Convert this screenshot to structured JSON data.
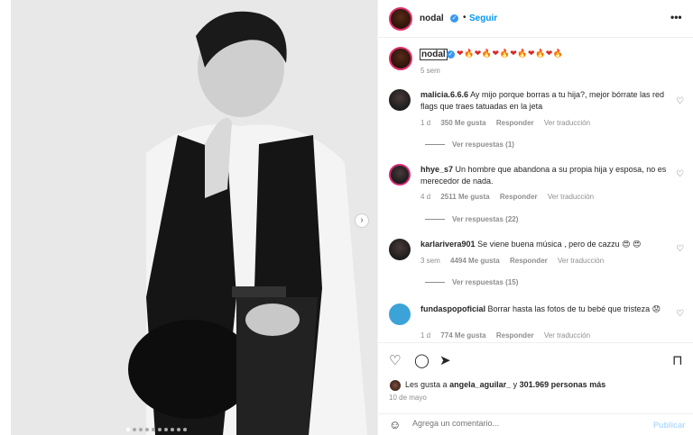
{
  "post": {
    "username": "nodal",
    "follow_label": "Seguir",
    "separator": "•",
    "more_label": "•••"
  },
  "caption": {
    "username": "nodal",
    "text": "❤🔥❤🔥❤🔥❤🔥❤🔥❤🔥",
    "time": "5 sem"
  },
  "comments": [
    {
      "user": "malicia.6.6.6",
      "text": "Ay mijo porque borras a tu hija?, mejor bórrate las red flags que traes tatuadas en la jeta",
      "time": "1 d",
      "likes": "350 Me gusta",
      "reply_label": "Responder",
      "translate_label": "Ver traducción",
      "replies": "Ver respuestas (1)"
    },
    {
      "user": "hhye_s7",
      "text": "Un hombre que abandona a su propia hija y esposa, no es merecedor de nada.",
      "time": "4 d",
      "likes": "2511 Me gusta",
      "reply_label": "Responder",
      "translate_label": "Ver traducción",
      "replies": "Ver respuestas (22)"
    },
    {
      "user": "karlarivera901",
      "text": "Se viene buena música , pero de cazzu 😍 😍",
      "time": "3 sem",
      "likes": "4494 Me gusta",
      "reply_label": "Responder",
      "translate_label": "Ver traducción",
      "replies": "Ver respuestas (15)"
    },
    {
      "user": "fundaspopoficial",
      "text": "Borrar hasta las fotos de tu bebé que tristeza 😟",
      "time": "1 d",
      "likes": "774 Me gusta",
      "reply_label": "Responder",
      "translate_label": "Ver traducción"
    }
  ],
  "likes": {
    "prefix": "Les gusta a",
    "user": "angela_aguilar_",
    "middle": "y",
    "count": "301.969 personas más"
  },
  "date": "10 de mayo",
  "comment_box": {
    "placeholder": "Agrega un comentario...",
    "publish_label": "Publicar"
  },
  "icons": {
    "heart": "heart-icon",
    "comment": "comment-icon",
    "share": "share-icon",
    "save": "bookmark-icon",
    "emoji": "emoji-icon",
    "next": "chevron-right-icon"
  },
  "colors": {
    "accent": "#0095f6",
    "verified": "#3897f0",
    "muted": "#8e8e8e",
    "publish_disabled": "#b3dbff"
  },
  "carousel": {
    "slide_count": 10,
    "active_index": 0
  }
}
